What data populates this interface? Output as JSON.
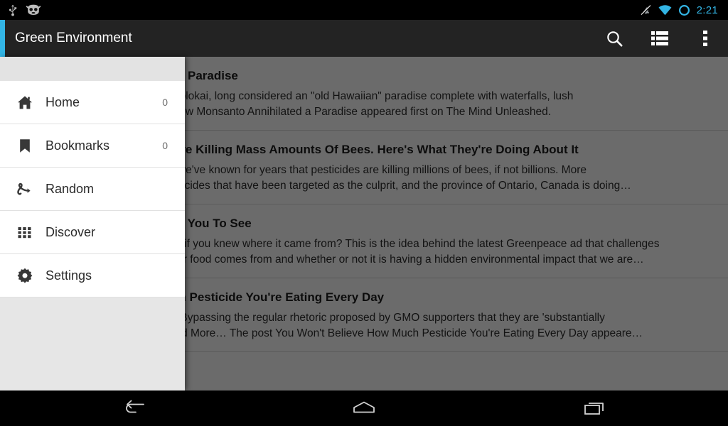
{
  "statusbar": {
    "time": "2:21",
    "icons": [
      "usb-icon",
      "cyanogenmod-icon",
      "ringer-silent-icon",
      "wifi-icon",
      "battery-circle-icon"
    ],
    "accent_color": "#33b5e5"
  },
  "actionbar": {
    "title": "Green Environment",
    "accent_color": "#33b5e5",
    "background": "#232323",
    "actions": [
      {
        "name": "search-icon",
        "label": "Search"
      },
      {
        "name": "list-view-icon",
        "label": "List view"
      },
      {
        "name": "overflow-menu-icon",
        "label": "More options"
      }
    ]
  },
  "drawer": {
    "items": [
      {
        "icon": "home-icon",
        "label": "Home",
        "count": "0"
      },
      {
        "icon": "bookmark-icon",
        "label": "Bookmarks",
        "count": "0"
      },
      {
        "icon": "random-icon",
        "label": "Random",
        "count": ""
      },
      {
        "icon": "grid-icon",
        "label": "Discover",
        "count": ""
      },
      {
        "icon": "gear-icon",
        "label": "Settings",
        "count": ""
      }
    ]
  },
  "articles": [
    {
      "title": "How Monsanto Annihilated A Paradise",
      "line1": "Home to the beautiful island of Molokai, long considered an \"old Hawaiian\" paradise complete with waterfalls, lush",
      "line2": "rainforests, pristine…  The post How Monsanto Annihilated a Paradise appeared first on The Mind Unleashed."
    },
    {
      "title": "Canada Admits Pesticides Are Killing Mass Amounts Of Bees. Here's What They're Doing About It",
      "line1": "Anthony Gucciardi It seems that we've known for years that pesticides are killing millions of bees, if not billions. More",
      "line2": "specifically, it's neonicotinoid pesticides that have been targeted as the culprit, and the province of Ontario, Canada is doing…"
    },
    {
      "title": "The Ad Doritos Doesn't Want You To See",
      "line1": "Would your snack taste the same if you knew where it came from? This is the idea behind the latest Greenpeace ad that challenges",
      "line2": "consumers to consider where their food comes from and whether or not it is having a hidden environmental impact that we are…"
    },
    {
      "title": "You Won't Believe How Much Pesticide You're Eating Every Day",
      "line1": "Christina Sarich, Natural Society Bypassing the regular rhetoric proposed by GMO supporters that they are 'substantially",
      "line2": "equivalent' to non-GM crops,'Read More…  The post You Won't Believe How Much Pesticide You're Eating Every Day appeare…"
    }
  ],
  "navbar": {
    "buttons": [
      {
        "name": "back-button",
        "label": "Back"
      },
      {
        "name": "home-button",
        "label": "Home"
      },
      {
        "name": "recents-button",
        "label": "Recent apps"
      }
    ]
  }
}
